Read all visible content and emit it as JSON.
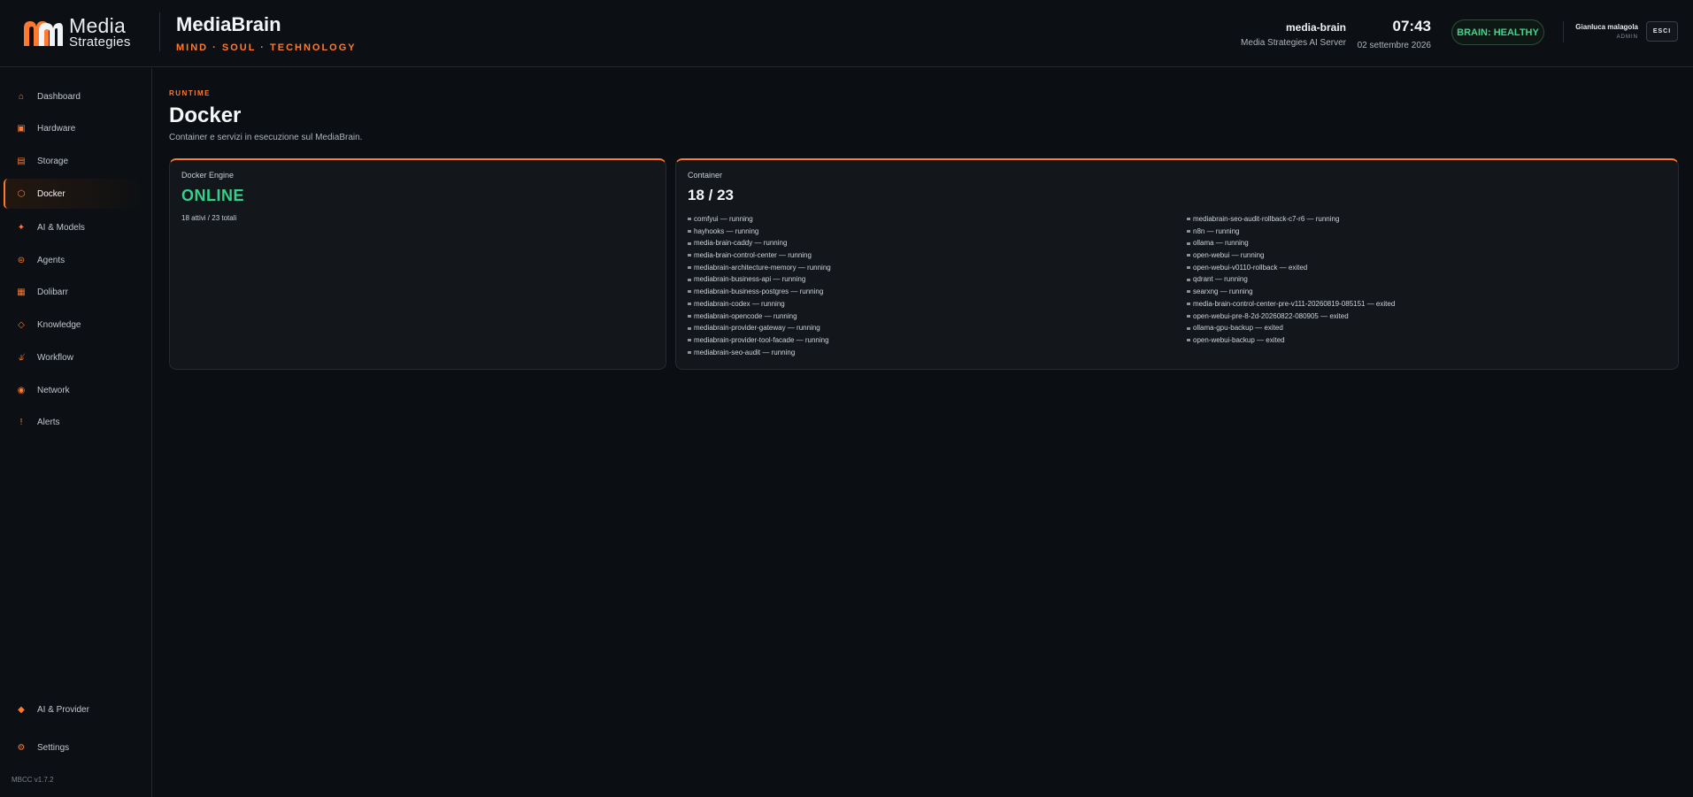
{
  "header": {
    "logo": {
      "line1": "Media",
      "line2": "Strategies"
    },
    "title": "MediaBrain",
    "subtitle": "MIND · SOUL · TECHNOLOGY",
    "server_name": "media-brain",
    "server_desc": "Media Strategies AI Server",
    "time": "07:43",
    "date": "02 settembre 2026",
    "health": "BRAIN: HEALTHY",
    "user_name": "Gianluca malagola",
    "user_role": "ADMIN",
    "logout_label": "ESCI"
  },
  "sidebar": {
    "items": [
      {
        "label": "Dashboard",
        "icon": "home-icon"
      },
      {
        "label": "Hardware",
        "icon": "chip-icon"
      },
      {
        "label": "Storage",
        "icon": "storage-icon"
      },
      {
        "label": "Docker",
        "icon": "hexagon-icon",
        "active": true
      },
      {
        "label": "AI & Models",
        "icon": "sparkle-icon"
      },
      {
        "label": "Agents",
        "icon": "agents-icon"
      },
      {
        "label": "Dolibarr",
        "icon": "grid-icon"
      },
      {
        "label": "Knowledge",
        "icon": "diamond-icon"
      },
      {
        "label": "Workflow",
        "icon": "workflow-icon"
      },
      {
        "label": "Network",
        "icon": "network-icon"
      },
      {
        "label": "Alerts",
        "icon": "alert-icon"
      }
    ],
    "bottom_items": [
      {
        "label": "AI & Provider",
        "icon": "provider-icon"
      },
      {
        "label": "Settings",
        "icon": "gear-icon"
      }
    ],
    "version": "MBCC v1.7.2"
  },
  "main": {
    "eyebrow": "RUNTIME",
    "title": "Docker",
    "description": "Container e servizi in esecuzione sul MediaBrain.",
    "engine_card": {
      "label": "Docker Engine",
      "status": "ONLINE",
      "summary": "18 attivi / 23 totali"
    },
    "container_card": {
      "label": "Container",
      "count": "18 / 23",
      "column1": [
        "comfyui — running",
        "hayhooks — running",
        "media-brain-caddy — running",
        "media-brain-control-center — running",
        "mediabrain-architecture-memory — running",
        "mediabrain-business-api — running",
        "mediabrain-business-postgres — running",
        "mediabrain-codex — running",
        "mediabrain-opencode — running",
        "mediabrain-provider-gateway — running",
        "mediabrain-provider-tool-facade — running",
        "mediabrain-seo-audit — running"
      ],
      "column2": [
        "mediabrain-seo-audit-rollback-c7-r6 — running",
        "n8n — running",
        "ollama — running",
        "open-webui — running",
        "open-webui-v0110-rollback — exited",
        "qdrant — running",
        "searxng — running",
        "media-brain-control-center-pre-v111-20260819-085151 — exited",
        "open-webui-pre-8-2d-20260822-080905 — exited",
        "ollama-gpu-backup — exited",
        "open-webui-backup — exited"
      ]
    }
  },
  "colors": {
    "accent": "#ff7a2e",
    "online": "#36d08a",
    "background": "#0b0e12"
  }
}
